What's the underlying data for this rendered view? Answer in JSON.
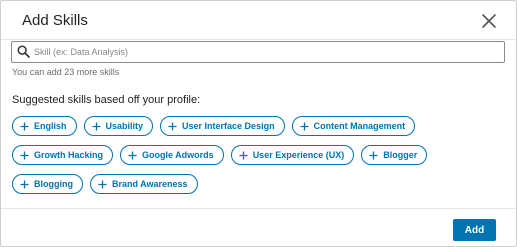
{
  "dialog": {
    "title": "Add Skills",
    "close_icon": "close-icon"
  },
  "search": {
    "placeholder": "Skill (ex: Data Analysis)",
    "value": "",
    "icon": "search-icon"
  },
  "hint": "You can add 23 more skills",
  "suggested": {
    "label": "Suggested skills based off your profile:",
    "chips": [
      "English",
      "Usability",
      "User Interface Design",
      "Content Management",
      "Growth Hacking",
      "Google Adwords",
      "User Experience (UX)",
      "Blogger",
      "Blogging",
      "Brand Awareness"
    ]
  },
  "footer": {
    "add_label": "Add"
  },
  "colors": {
    "accent": "#0073b1",
    "text": "#222222",
    "muted": "#6b6b6b"
  }
}
